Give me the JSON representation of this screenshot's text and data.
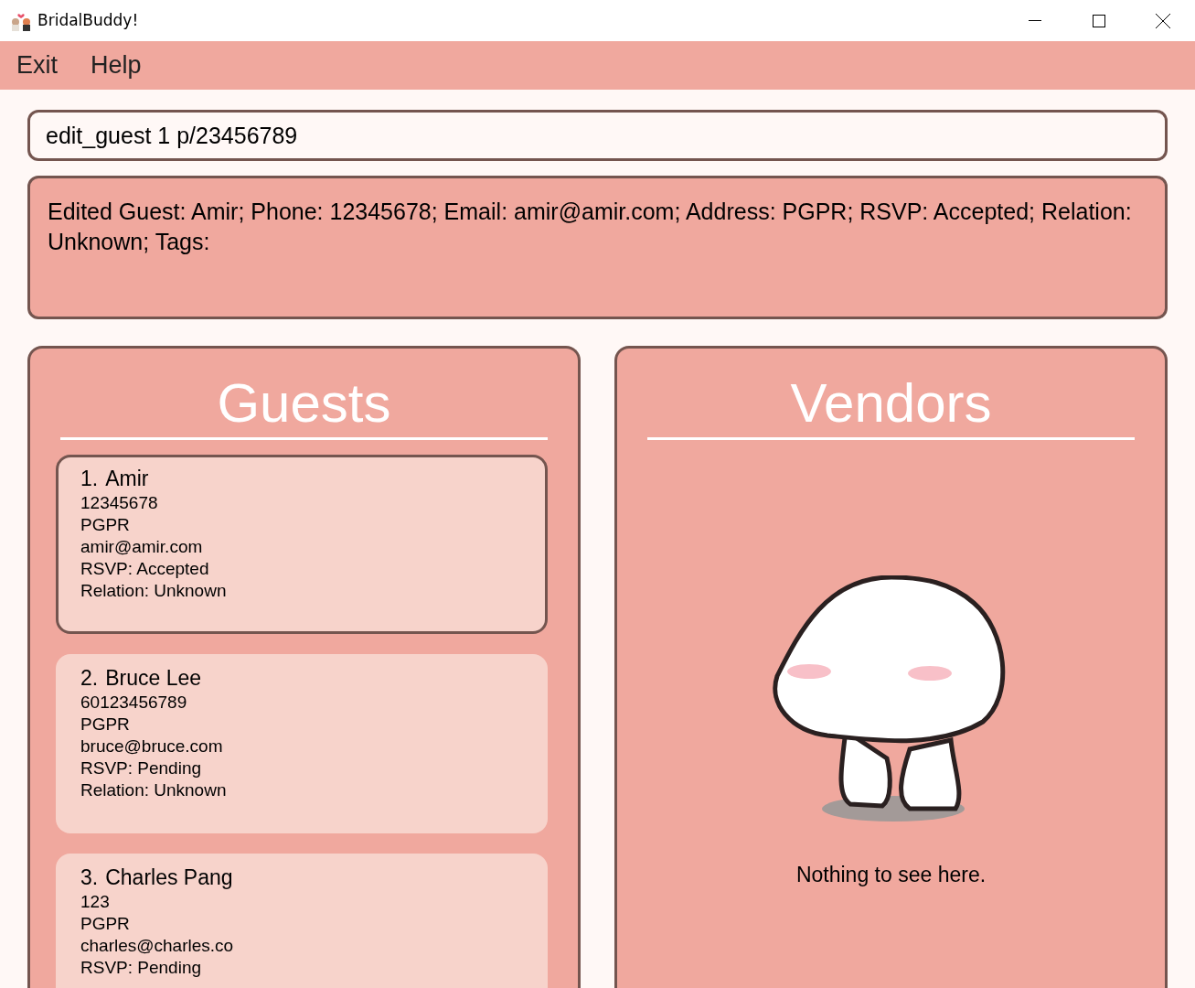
{
  "window": {
    "title": "BridalBuddy!"
  },
  "menu": [
    "Exit",
    "Help"
  ],
  "command": {
    "value": "edit_guest 1 p/23456789"
  },
  "result": "Edited Guest: Amir; Phone: 12345678; Email: amir@amir.com; Address: PGPR; RSVP: Accepted; Relation: Unknown; Tags:",
  "guests": {
    "title": "Guests",
    "items": [
      {
        "index": "1.",
        "name": "Amir",
        "lines": [
          "12345678",
          "PGPR",
          "amir@amir.com",
          "RSVP: Accepted",
          "Relation: Unknown"
        ],
        "selected": true
      },
      {
        "index": "2.",
        "name": "Bruce Lee",
        "lines": [
          "60123456789",
          "PGPR",
          "bruce@bruce.com",
          "RSVP: Pending",
          "Relation: Unknown"
        ],
        "selected": false
      },
      {
        "index": "3.",
        "name": "Charles Pang",
        "lines": [
          "123",
          "PGPR",
          "charles@charles.co",
          "RSVP: Pending"
        ],
        "selected": false
      }
    ]
  },
  "vendors": {
    "title": "Vendors",
    "empty_message": "Nothing to see here."
  }
}
